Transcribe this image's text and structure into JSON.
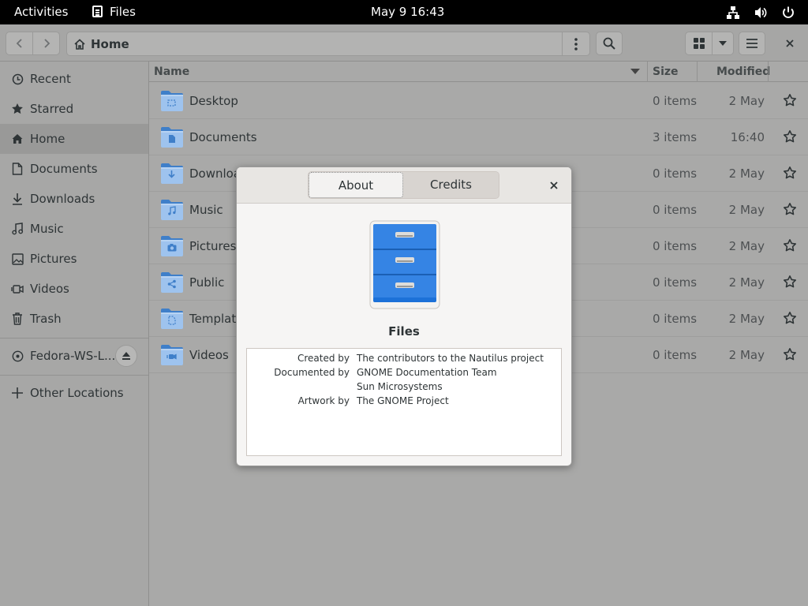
{
  "topbar": {
    "activities": "Activities",
    "app_name": "Files",
    "clock": "May 9  16:43"
  },
  "headerbar": {
    "location": "Home"
  },
  "sidebar": {
    "items": [
      {
        "label": "Recent",
        "icon": "clock-icon"
      },
      {
        "label": "Starred",
        "icon": "star-icon"
      },
      {
        "label": "Home",
        "icon": "home-icon",
        "selected": true
      },
      {
        "label": "Documents",
        "icon": "document-icon"
      },
      {
        "label": "Downloads",
        "icon": "download-icon"
      },
      {
        "label": "Music",
        "icon": "music-icon"
      },
      {
        "label": "Pictures",
        "icon": "picture-icon"
      },
      {
        "label": "Videos",
        "icon": "video-icon"
      },
      {
        "label": "Trash",
        "icon": "trash-icon"
      }
    ],
    "volume": "Fedora-WS-L...",
    "other_locations": "Other Locations"
  },
  "list": {
    "columns": {
      "name": "Name",
      "size": "Size",
      "modified": "Modified"
    },
    "rows": [
      {
        "name": "Desktop",
        "size": "0 items",
        "modified": "2 May",
        "emblem": "desktop"
      },
      {
        "name": "Documents",
        "size": "3 items",
        "modified": "16:40",
        "emblem": "document"
      },
      {
        "name": "Download",
        "size": "0 items",
        "modified": "2 May",
        "emblem": "download"
      },
      {
        "name": "Music",
        "size": "0 items",
        "modified": "2 May",
        "emblem": "music"
      },
      {
        "name": "Pictures",
        "size": "0 items",
        "modified": "2 May",
        "emblem": "camera"
      },
      {
        "name": "Public",
        "size": "0 items",
        "modified": "2 May",
        "emblem": "share"
      },
      {
        "name": "Template",
        "size": "0 items",
        "modified": "2 May",
        "emblem": "template"
      },
      {
        "name": "Videos",
        "size": "0 items",
        "modified": "2 May",
        "emblem": "video"
      }
    ]
  },
  "about_dialog": {
    "tabs": {
      "about": "About",
      "credits": "Credits"
    },
    "app_name": "Files",
    "credits": [
      {
        "label": "Created by",
        "value": "The contributors to the Nautilus project"
      },
      {
        "label": "Documented by",
        "value": "GNOME Documentation Team"
      },
      {
        "label": "",
        "value": "Sun Microsystems"
      },
      {
        "label": "Artwork by",
        "value": "The GNOME Project"
      }
    ]
  },
  "colors": {
    "folder_blue": "#3f7fc9",
    "folder_light": "#9ec3ee",
    "cabinet_blue": "#3584e4"
  }
}
